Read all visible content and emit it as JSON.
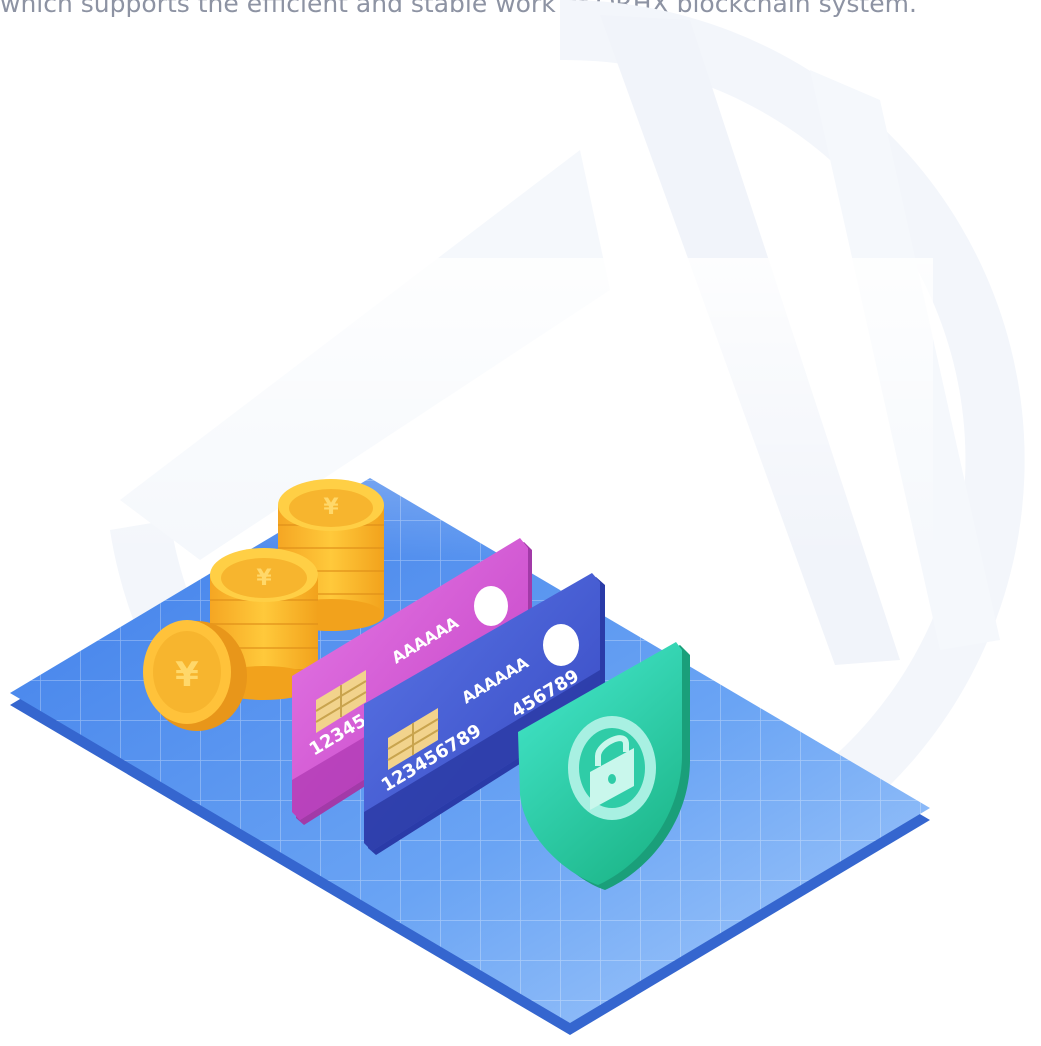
{
  "intro": {
    "text": "which supports the efficient and stable work of QRHX blockchain system."
  },
  "illustration": {
    "scene": "security-payments",
    "colors": {
      "floor": "#5d93f0",
      "floor_edge": "#3f6fd3",
      "card_pink": "#d85fd7",
      "card_blue": "#4c5fd6",
      "coin": "#f7b52e",
      "shield": "#35d6b4",
      "watermark": "#f4f7fb"
    },
    "card_pink": {
      "holder": "AAAAAA",
      "number": "12345"
    },
    "card_blue": {
      "holder": "AAAAAA",
      "number_left": "123456789",
      "number_right": "456789"
    },
    "icons": [
      "yen-coin-icon",
      "lock-icon",
      "shield-icon",
      "chip-icon"
    ]
  }
}
